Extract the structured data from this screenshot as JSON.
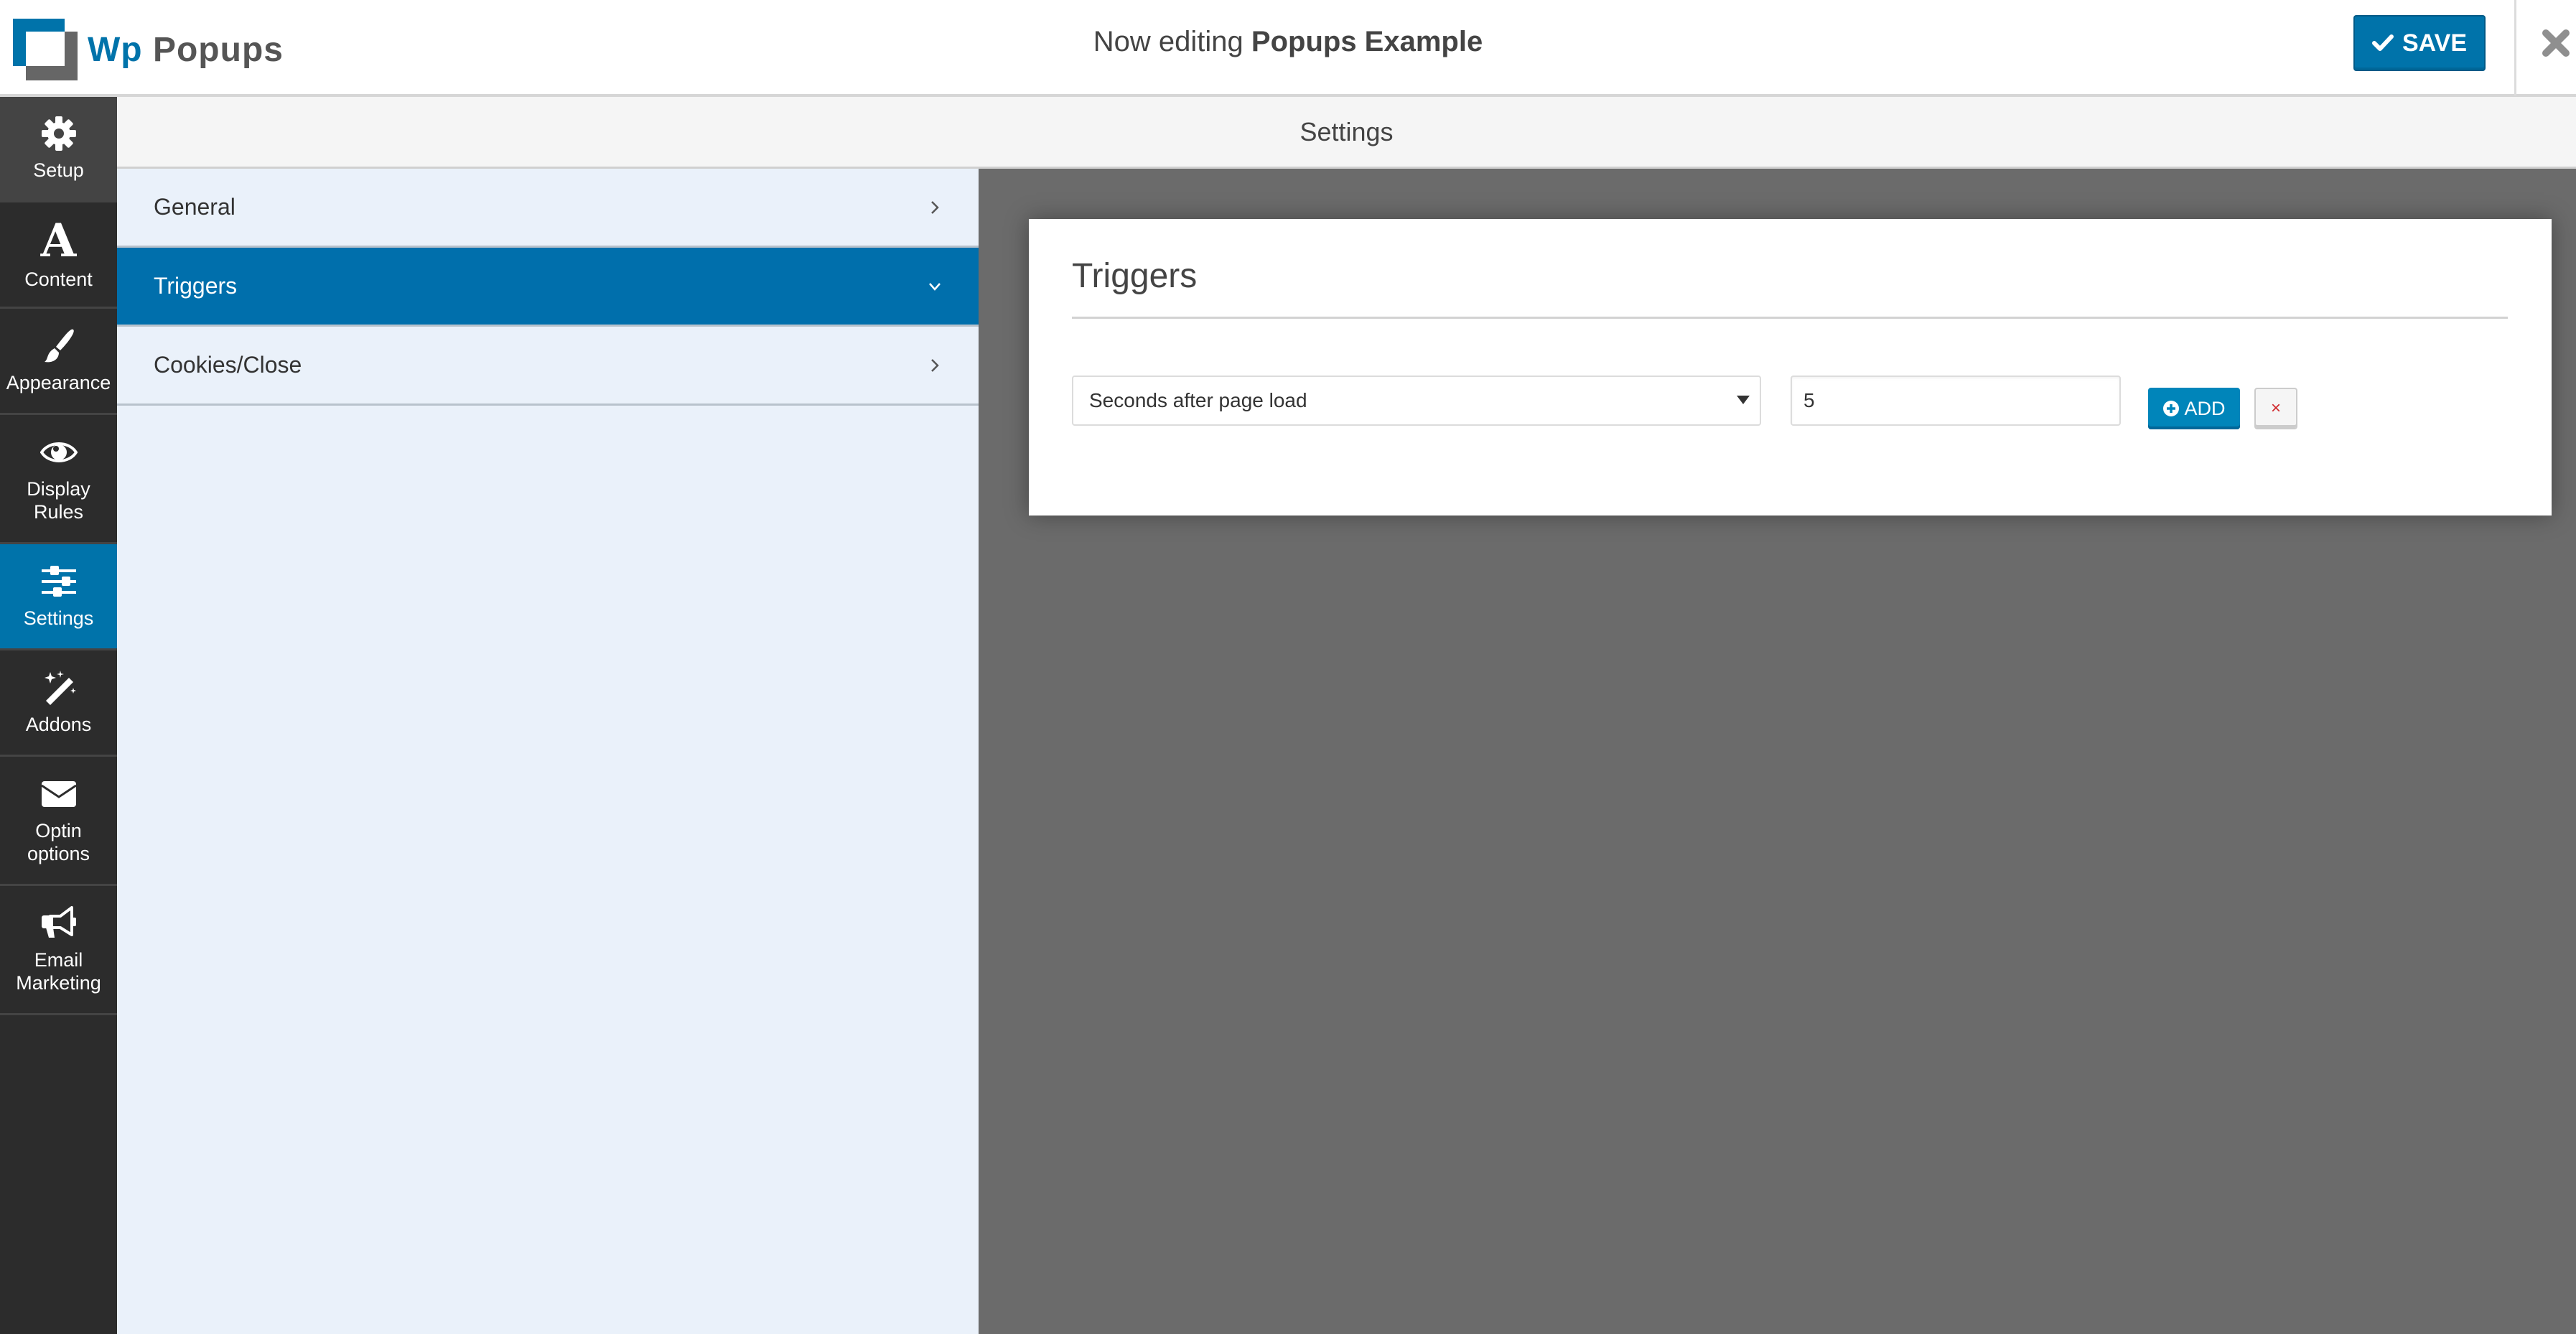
{
  "header": {
    "logo": {
      "part1": "Wp",
      "part2": "Popups",
      "icon": "wp-popups-logo-icon"
    },
    "title_prefix": "Now editing",
    "title_name": "Popups Example",
    "save_label": "SAVE",
    "save_icon": "check-icon",
    "close_icon": "close-icon"
  },
  "colors": {
    "accent": "#0073aa",
    "sidebar_bg": "#2c2c2c",
    "panel_bg": "#eaf1fa",
    "canvas_bg": "#6b6b6b",
    "remove_red": "#d0262a"
  },
  "sidebar": {
    "items": [
      {
        "label": "Setup",
        "icon": "gear-icon"
      },
      {
        "label": "Content",
        "icon": "font-a-icon"
      },
      {
        "label": "Appearance",
        "icon": "paintbrush-icon"
      },
      {
        "label": "Display\nRules",
        "line1": "Display",
        "line2": "Rules",
        "icon": "eye-icon"
      },
      {
        "label": "Settings",
        "icon": "sliders-icon",
        "active": true
      },
      {
        "label": "Addons",
        "icon": "magic-wand-icon"
      },
      {
        "label": "Optin\noptions",
        "line1": "Optin",
        "line2": "options",
        "icon": "envelope-icon"
      },
      {
        "label": "Email\nMarketing",
        "line1": "Email",
        "line2": "Marketing",
        "icon": "megaphone-icon"
      }
    ]
  },
  "settings_bar": {
    "title": "Settings"
  },
  "panel": {
    "items": [
      {
        "label": "General",
        "icon": "chevron-right-icon",
        "active": false
      },
      {
        "label": "Triggers",
        "icon": "chevron-down-icon",
        "active": true
      },
      {
        "label": "Cookies/Close",
        "icon": "chevron-right-icon",
        "active": false
      }
    ]
  },
  "card": {
    "title": "Triggers",
    "trigger_row": {
      "select_value": "Seconds after page load",
      "input_value": "5",
      "add_label": "ADD",
      "add_icon": "plus-circle-icon",
      "remove_label": "×",
      "remove_icon": "remove-x-icon"
    }
  }
}
